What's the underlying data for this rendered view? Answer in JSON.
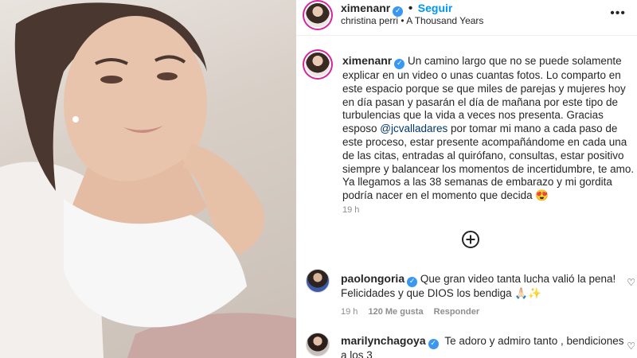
{
  "header": {
    "username": "ximenanr",
    "follow_label": "Seguir",
    "audio": "christina perri • A Thousand Years",
    "more_label": "•••"
  },
  "caption": {
    "username": "ximenanr",
    "text_before_mention": "Un camino largo que no se puede solamente explicar en un video o unas cuantas fotos. Lo comparto en este espacio porque se que miles de parejas y mujeres hoy en día pasan y pasarán el día de mañana por este tipo de turbulencias que la vida a veces nos presenta. Gracias esposo ",
    "mention": "@jcvalladares",
    "text_after_mention": " por tomar mi mano a cada paso de este proceso, estar presente acompañándome en cada una de las citas, entradas al quirófano, consultas, estar positivo siempre y balancear los momentos de incertidumbre, te amo. Ya llegamos a las 38 semanas de embarazo y mi gordita podría nacer en el momento que decida 😍",
    "time": "19 h"
  },
  "load_more_icon": "plus-circle-icon",
  "comments": [
    {
      "username": "paolongoria",
      "text": "Que gran video tanta lucha valió la pena! Felicidades y que DIOS los bendiga 🙏🏻✨",
      "time": "19 h",
      "likes": "120 Me gusta",
      "reply": "Responder"
    },
    {
      "username": "marilynchagoya",
      "text": "Te adoro y admiro tanto , bendiciones a los 3"
    }
  ],
  "colors": {
    "accent": "#0095f6",
    "verified": "#3897f0",
    "muted": "#8e8e8e"
  }
}
